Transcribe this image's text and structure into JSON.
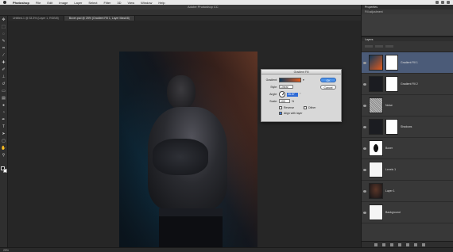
{
  "menubar": {
    "app_name": "Photoshop",
    "items": [
      "File",
      "Edit",
      "Image",
      "Layer",
      "Select",
      "Filter",
      "3D",
      "View",
      "Window",
      "Help"
    ]
  },
  "window_title": "Adobe Photoshop CC",
  "tabs": [
    {
      "label": "Untitled-1 @ 33.3% (Layer 1, RGB/8)"
    },
    {
      "label": "Boxer.psd @ 25% (Gradient Fill 1, Layer Mask/8)"
    }
  ],
  "gradient_dialog": {
    "title": "Gradient Fill",
    "gradient_label": "Gradient:",
    "style_label": "Style:",
    "style_value": "Linear",
    "angle_label": "Angle:",
    "angle_value": "26.57",
    "angle_unit": "°",
    "scale_label": "Scale:",
    "scale_value": "100",
    "scale_unit": "%",
    "reverse_label": "Reverse",
    "reverse_checked": false,
    "dither_label": "Dither",
    "dither_checked": false,
    "align_label": "Align with layer",
    "align_checked": true,
    "ok_label": "OK",
    "cancel_label": "Cancel",
    "gradient_colors": [
      "#12395a",
      "#e05a1e"
    ]
  },
  "panels": {
    "properties_title": "Properties",
    "properties_sub": "Fill adjustment",
    "layers_title": "Layers"
  },
  "layers": [
    {
      "name": "Gradient Fill 1",
      "thumb": "gradient",
      "active": true
    },
    {
      "name": "Gradient Fill 2",
      "thumb": "dark",
      "active": false
    },
    {
      "name": "Noise",
      "thumb": "noise",
      "active": false
    },
    {
      "name": "Shadows",
      "thumb": "dark",
      "active": false
    },
    {
      "name": "Boxer",
      "thumb": "silhouette",
      "active": false
    },
    {
      "name": "Levels 1",
      "thumb": "white",
      "active": false
    },
    {
      "name": "Layer 1",
      "thumb": "photo",
      "active": false
    },
    {
      "name": "Background",
      "thumb": "white",
      "active": false
    }
  ],
  "status_text": "25%",
  "colors": {
    "accent": "#4d93ea",
    "active_layer": "#4b5b78",
    "canvas_bg": "#262626"
  }
}
